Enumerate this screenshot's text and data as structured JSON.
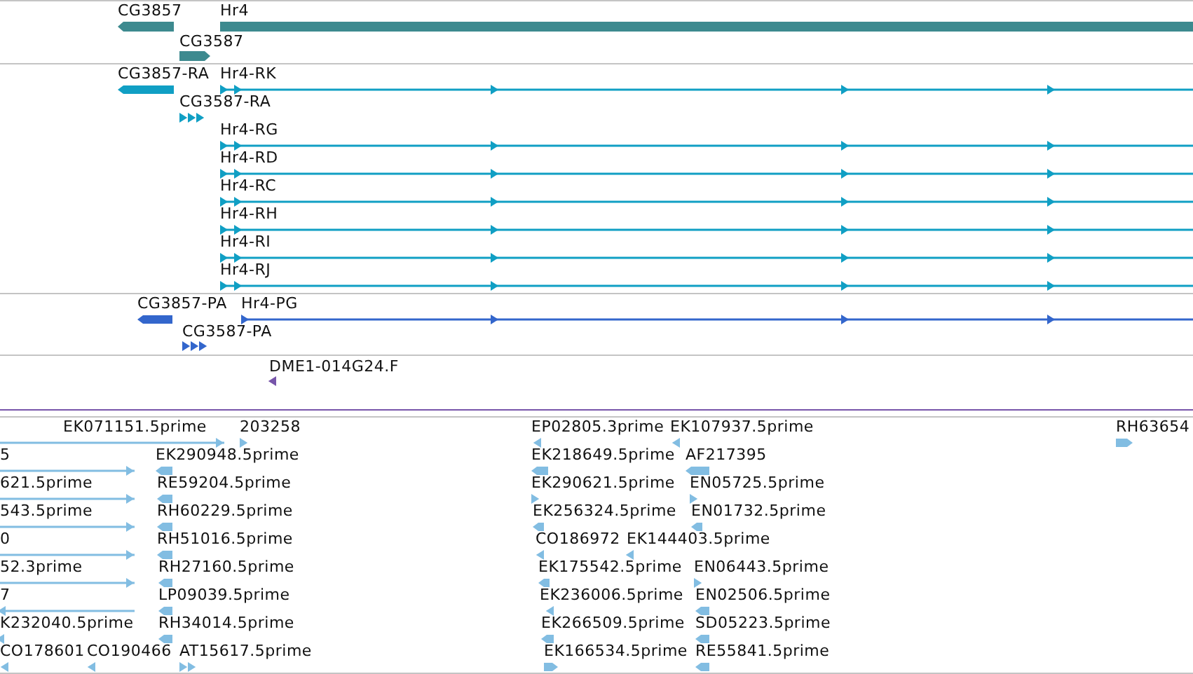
{
  "tracks": [
    {
      "kind": "gene",
      "features": [
        {
          "label": "CG3857",
          "kind": "bar",
          "reverse": true
        },
        {
          "label": "Hr4",
          "kind": "bar",
          "reverse": false
        },
        {
          "label": "CG3587",
          "kind": "bar",
          "reverse": false
        }
      ]
    },
    {
      "kind": "transcript",
      "features": [
        {
          "label": "CG3857-RA",
          "kind": "bar",
          "reverse": true
        },
        {
          "label": "Hr4-RK",
          "kind": "line",
          "reverse": false
        },
        {
          "label": "CG3587-RA",
          "kind": "arrows",
          "reverse": false
        },
        {
          "label": "Hr4-RG",
          "kind": "line",
          "reverse": false
        },
        {
          "label": "Hr4-RD",
          "kind": "line",
          "reverse": false
        },
        {
          "label": "Hr4-RC",
          "kind": "line",
          "reverse": false
        },
        {
          "label": "Hr4-RH",
          "kind": "line",
          "reverse": false
        },
        {
          "label": "Hr4-RI",
          "kind": "line",
          "reverse": false
        },
        {
          "label": "Hr4-RJ",
          "kind": "line",
          "reverse": false
        }
      ]
    },
    {
      "kind": "protein",
      "features": [
        {
          "label": "CG3857-PA",
          "kind": "bar",
          "reverse": true
        },
        {
          "label": "Hr4-PG",
          "kind": "line",
          "reverse": false
        },
        {
          "label": "CG3587-PA",
          "kind": "arrows",
          "reverse": false
        }
      ]
    },
    {
      "kind": "clone",
      "features": [
        {
          "label": "DME1-014G24.F",
          "kind": "tick",
          "reverse": true
        }
      ]
    },
    {
      "kind": "est",
      "features": [
        {
          "label": "EK071151.5prime",
          "kind": "line",
          "reverse": false
        },
        {
          "label": "203258",
          "kind": "tick",
          "reverse": false
        },
        {
          "label": "EP02805.3prime",
          "kind": "tick",
          "reverse": true
        },
        {
          "label": "EK107937.5prime",
          "kind": "tick",
          "reverse": true
        },
        {
          "label": "RH63654",
          "kind": "bar",
          "reverse": false
        },
        {
          "label": "5",
          "kind": "line",
          "reverse": false
        },
        {
          "label": "EK290948.5prime",
          "kind": "bar",
          "reverse": true
        },
        {
          "label": "EK218649.5prime",
          "kind": "bar",
          "reverse": true
        },
        {
          "label": "AF217395",
          "kind": "bar",
          "reverse": true
        },
        {
          "label": "621.5prime",
          "kind": "line",
          "reverse": false
        },
        {
          "label": "RE59204.5prime",
          "kind": "bar",
          "reverse": true
        },
        {
          "label": "EK290621.5prime",
          "kind": "tick",
          "reverse": false
        },
        {
          "label": "EN05725.5prime",
          "kind": "tick",
          "reverse": false
        },
        {
          "label": "543.5prime",
          "kind": "line",
          "reverse": false
        },
        {
          "label": "RH60229.5prime",
          "kind": "bar",
          "reverse": true
        },
        {
          "label": "EK256324.5prime",
          "kind": "bar",
          "reverse": true
        },
        {
          "label": "EN01732.5prime",
          "kind": "bar",
          "reverse": true
        },
        {
          "label": "0",
          "kind": "line",
          "reverse": false
        },
        {
          "label": "RH51016.5prime",
          "kind": "bar",
          "reverse": true
        },
        {
          "label": "CO186972",
          "kind": "tick",
          "reverse": true
        },
        {
          "label": "EK144403.5prime",
          "kind": "tick",
          "reverse": true
        },
        {
          "label": "52.3prime",
          "kind": "line",
          "reverse": false
        },
        {
          "label": "RH27160.5prime",
          "kind": "bar",
          "reverse": true
        },
        {
          "label": "EK175542.5prime",
          "kind": "bar",
          "reverse": true
        },
        {
          "label": "EN06443.5prime",
          "kind": "arrows",
          "reverse": false
        },
        {
          "label": "7",
          "kind": "line",
          "reverse": true
        },
        {
          "label": "LP09039.5prime",
          "kind": "bar",
          "reverse": true
        },
        {
          "label": "EK236006.5prime",
          "kind": "arrows",
          "reverse": true
        },
        {
          "label": "EN02506.5prime",
          "kind": "bar",
          "reverse": true
        },
        {
          "label": "K232040.5prime",
          "kind": "tick",
          "reverse": true
        },
        {
          "label": "RH34014.5prime",
          "kind": "bar",
          "reverse": true
        },
        {
          "label": "EK266509.5prime",
          "kind": "bar",
          "reverse": true
        },
        {
          "label": "SD05223.5prime",
          "kind": "bar",
          "reverse": true
        },
        {
          "label": "CO178601",
          "kind": "tick",
          "reverse": true
        },
        {
          "label": "CO190466",
          "kind": "tick",
          "reverse": true
        },
        {
          "label": "AT15617.5prime",
          "kind": "arrows",
          "reverse": false
        },
        {
          "label": "EK166534.5prime",
          "kind": "bar",
          "reverse": false
        },
        {
          "label": "RE55841.5prime",
          "kind": "bar",
          "reverse": true
        }
      ]
    }
  ]
}
